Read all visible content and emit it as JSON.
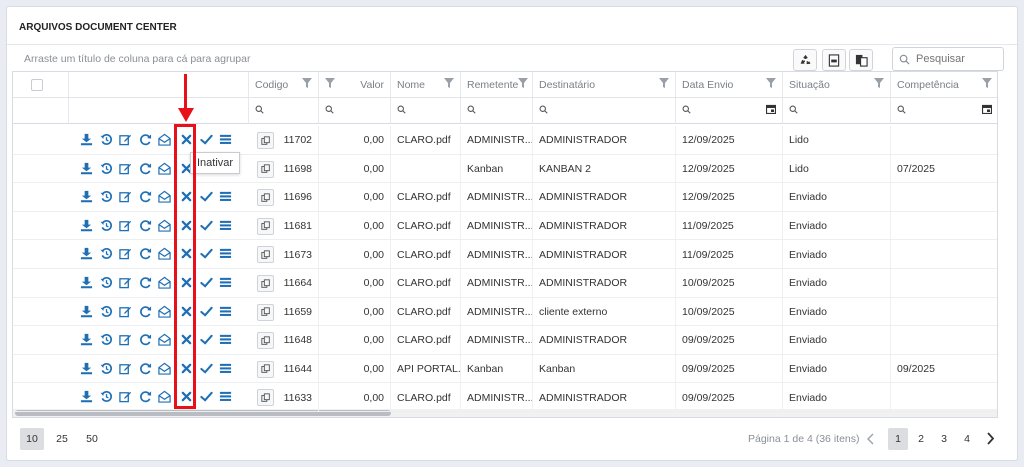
{
  "panel": {
    "title": "ARQUIVOS DOCUMENT CENTER"
  },
  "toolbar": {
    "group_hint": "Arraste um título de coluna para cá para agrupar",
    "search_placeholder": "Pesquisar",
    "tools": [
      "recycle-icon",
      "export-csv-icon",
      "column-chooser-icon"
    ]
  },
  "columns": [
    "Codigo",
    "Valor",
    "Nome",
    "Remetente",
    "Destinatário",
    "Data Envio",
    "Situação",
    "Competência"
  ],
  "row_actions": [
    "download-icon",
    "history-icon",
    "edit-icon",
    "refresh-icon",
    "email-open-icon",
    "inativar-x-icon",
    "check-icon",
    "list-icon"
  ],
  "tooltip": "Inativar",
  "rows": [
    {
      "codigo": "11702",
      "valor": "0,00",
      "nome": "CLARO.pdf",
      "remetente": "ADMINISTR...",
      "destinatario": "ADMINISTRADOR",
      "data_envio": "12/09/2025",
      "situacao": "Lido",
      "competencia": ""
    },
    {
      "codigo": "11698",
      "valor": "0,00",
      "nome": "",
      "remetente": "Kanban",
      "destinatario": "KANBAN 2",
      "data_envio": "12/09/2025",
      "situacao": "Lido",
      "competencia": "07/2025"
    },
    {
      "codigo": "11696",
      "valor": "0,00",
      "nome": "CLARO.pdf",
      "remetente": "ADMINISTR...",
      "destinatario": "ADMINISTRADOR",
      "data_envio": "12/09/2025",
      "situacao": "Enviado",
      "competencia": ""
    },
    {
      "codigo": "11681",
      "valor": "0,00",
      "nome": "CLARO.pdf",
      "remetente": "ADMINISTR...",
      "destinatario": "ADMINISTRADOR",
      "data_envio": "11/09/2025",
      "situacao": "Enviado",
      "competencia": ""
    },
    {
      "codigo": "11673",
      "valor": "0,00",
      "nome": "CLARO.pdf",
      "remetente": "ADMINISTR...",
      "destinatario": "ADMINISTRADOR",
      "data_envio": "11/09/2025",
      "situacao": "Enviado",
      "competencia": ""
    },
    {
      "codigo": "11664",
      "valor": "0,00",
      "nome": "CLARO.pdf",
      "remetente": "ADMINISTR...",
      "destinatario": "ADMINISTRADOR",
      "data_envio": "10/09/2025",
      "situacao": "Enviado",
      "competencia": ""
    },
    {
      "codigo": "11659",
      "valor": "0,00",
      "nome": "CLARO.pdf",
      "remetente": "ADMINISTR...",
      "destinatario": "cliente externo",
      "data_envio": "10/09/2025",
      "situacao": "Enviado",
      "competencia": ""
    },
    {
      "codigo": "11648",
      "valor": "0,00",
      "nome": "CLARO.pdf",
      "remetente": "ADMINISTR...",
      "destinatario": "ADMINISTRADOR",
      "data_envio": "09/09/2025",
      "situacao": "Enviado",
      "competencia": ""
    },
    {
      "codigo": "11644",
      "valor": "0,00",
      "nome": "API PORTAL...",
      "remetente": "Kanban",
      "destinatario": "Kanban",
      "data_envio": "09/09/2025",
      "situacao": "Enviado",
      "competencia": "09/2025"
    },
    {
      "codigo": "11633",
      "valor": "0,00",
      "nome": "CLARO.pdf",
      "remetente": "ADMINISTR...",
      "destinatario": "ADMINISTRADOR",
      "data_envio": "09/09/2025",
      "situacao": "Enviado",
      "competencia": ""
    }
  ],
  "pager": {
    "sizes": [
      "10",
      "25",
      "50"
    ],
    "active_size": "10",
    "info": "Página 1 de 4 (36 itens)",
    "pages": [
      "1",
      "2",
      "3",
      "4"
    ],
    "active_page": "1"
  },
  "colors": {
    "accent": "#1f6fb5",
    "highlight": "#e8111a"
  }
}
